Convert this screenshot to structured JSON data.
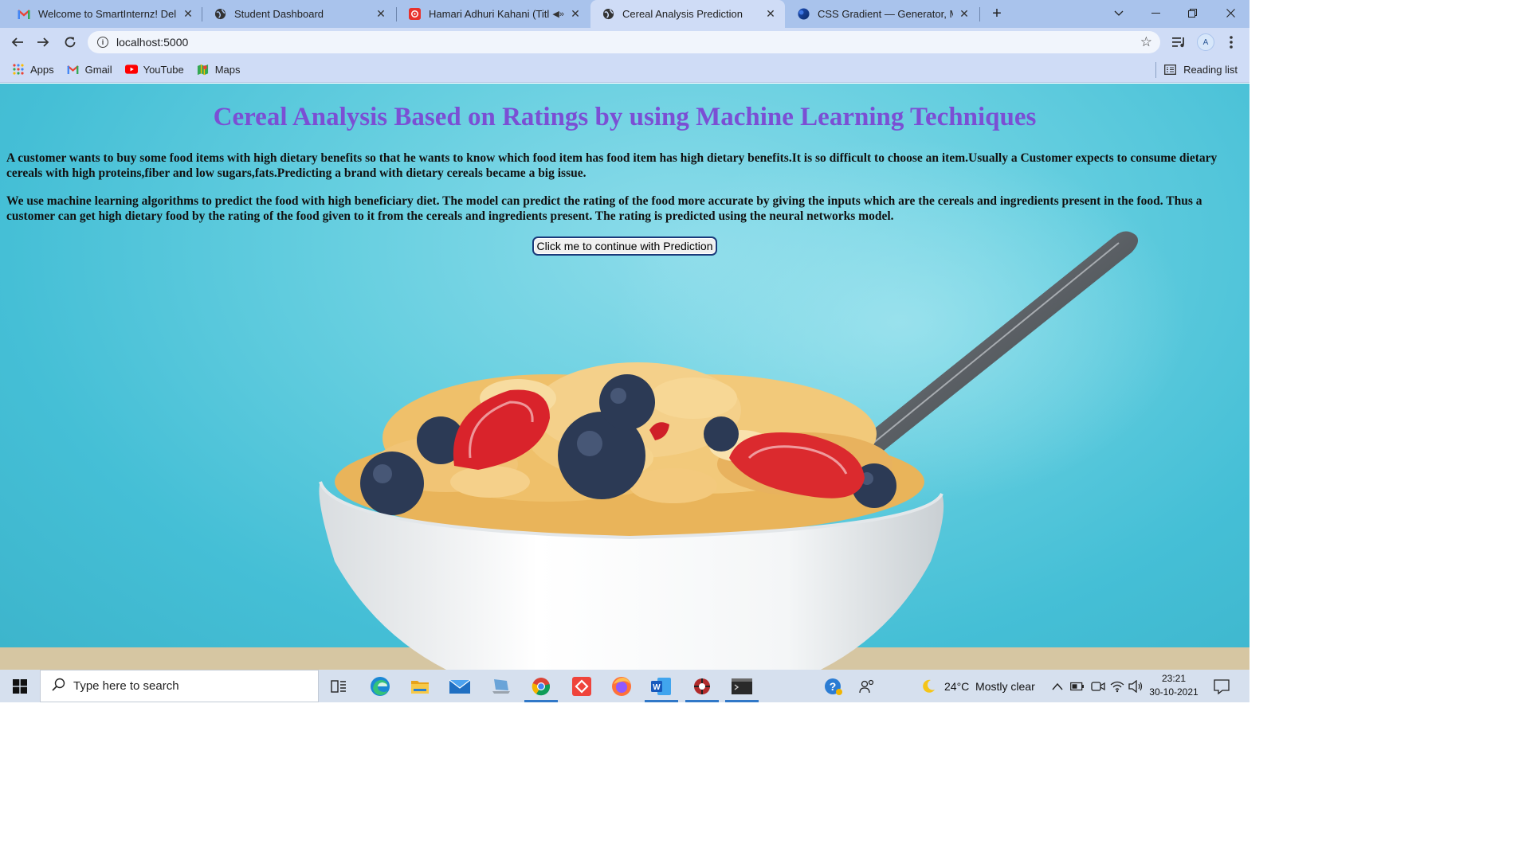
{
  "browser": {
    "tabs": [
      {
        "title": "Welcome to SmartInternz! Deligh",
        "icon": "gmail-icon"
      },
      {
        "title": "Student Dashboard",
        "icon": "globe-icon"
      },
      {
        "title": "Hamari Adhuri Kahani (Title T",
        "icon": "music-icon",
        "audio": "◀»"
      },
      {
        "title": "Cereal Analysis Prediction",
        "icon": "globe-icon",
        "active": true
      },
      {
        "title": "CSS Gradient — Generator, Make",
        "icon": "css-gradient-icon"
      }
    ],
    "address": "localhost:5000",
    "bookmarks": [
      "Apps",
      "Gmail",
      "YouTube",
      "Maps"
    ],
    "reading_list": "Reading list",
    "profile_initial": "A",
    "tab_close_glyph": "✕",
    "new_tab_glyph": "+"
  },
  "page": {
    "heading": "Cereal Analysis Based on Ratings by using Machine Learning Techniques",
    "paragraph1": "A customer wants to buy some food items with high dietary benefits so that he wants to know which food item has food item has high dietary benefits.It is so difficult to choose an item.Usually a Customer expects to consume dietary cereals with high proteins,fiber and low sugars,fats.Predicting a brand with dietary cereals became a big issue.",
    "paragraph2": "We use machine learning algorithms to predict the food with high beneficiary diet. The model can predict the rating of the food more accurate by giving the inputs which are the cereals and ingredients present in the food. Thus a customer can get high dietary food by the rating of the food given to it from the cereals and ingredients present. The rating is predicted using the neural networks model.",
    "button_label": "Click me to continue with Prediction",
    "heading_color": "#7b4fd4",
    "background_color": "#5ccbdf"
  },
  "taskbar": {
    "search_placeholder": "Type here to search",
    "weather": "24°C  Mostly clear",
    "time": "23:21",
    "date": "30-10-2021",
    "pinned": [
      "task-view-icon",
      "edge-icon",
      "file-explorer-icon",
      "mail-icon",
      "laptop-icon",
      "chrome-icon",
      "anydesk-icon",
      "firefox-icon",
      "word-icon",
      "app-icon",
      "terminal-icon"
    ]
  }
}
